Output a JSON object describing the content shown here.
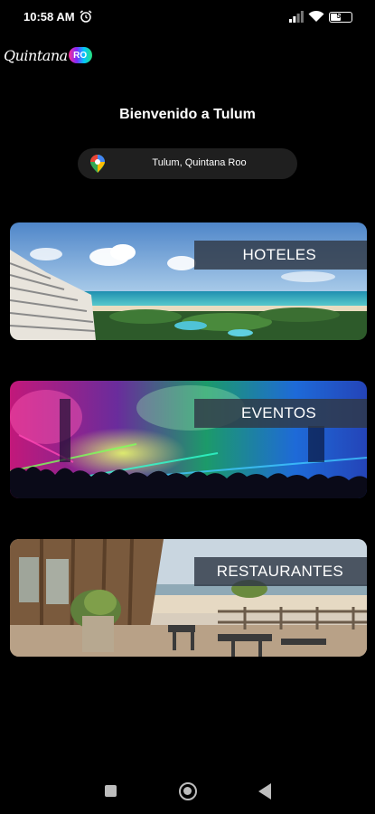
{
  "status_bar": {
    "time": "10:58 AM",
    "battery_level": 0.56,
    "battery_text": "56",
    "icons": [
      "alarm-icon",
      "signal-icon",
      "wifi-icon",
      "battery-icon"
    ]
  },
  "logo": {
    "text": "Quintana",
    "badge": "RO"
  },
  "header": {
    "title": "Bienvenido a Tulum"
  },
  "location": {
    "icon": "map-pin-icon",
    "label": "Tulum, Quintana Roo"
  },
  "categories": [
    {
      "label": "HOTELES",
      "image": "beach-hotel-photo"
    },
    {
      "label": "EVENTOS",
      "image": "concert-crowd-photo"
    },
    {
      "label": "RESTAURANTES",
      "image": "terrace-restaurant-photo"
    }
  ],
  "nav_bar": {
    "icons": [
      "recents-icon",
      "home-icon",
      "back-icon"
    ]
  },
  "colors": {
    "background": "#000000",
    "pill": "#1f1f1f",
    "label_bg": "#303846",
    "nav_icons": "#bdbdbd"
  }
}
